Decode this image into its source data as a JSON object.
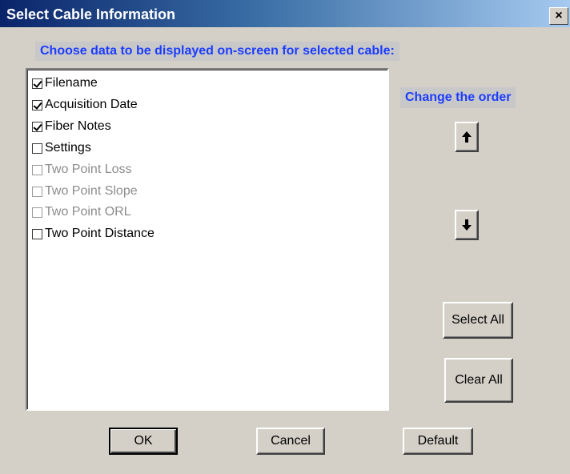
{
  "window": {
    "title": "Select Cable Information",
    "close_glyph": "×"
  },
  "instruction": "Choose data to be displayed on-screen for selected cable:",
  "items": [
    {
      "label": "Filename",
      "checked": true,
      "enabled": true
    },
    {
      "label": "Acquisition Date",
      "checked": true,
      "enabled": true
    },
    {
      "label": "Fiber Notes",
      "checked": true,
      "enabled": true
    },
    {
      "label": "Settings",
      "checked": false,
      "enabled": true
    },
    {
      "label": "Two Point Loss",
      "checked": false,
      "enabled": false
    },
    {
      "label": "Two Point Slope",
      "checked": false,
      "enabled": false
    },
    {
      "label": "Two Point ORL",
      "checked": false,
      "enabled": false
    },
    {
      "label": "Two Point Distance",
      "checked": false,
      "enabled": true
    }
  ],
  "order": {
    "label": "Change the order",
    "up_icon": "arrow-up-icon",
    "down_icon": "arrow-down-icon"
  },
  "buttons": {
    "select_all": "Select All",
    "clear_all": "Clear All",
    "ok": "OK",
    "cancel": "Cancel",
    "default": "Default"
  },
  "colors": {
    "title_bar": "#0a246a",
    "accent_text": "#1c3cff",
    "dialog_bg": "#d4d0c8"
  }
}
